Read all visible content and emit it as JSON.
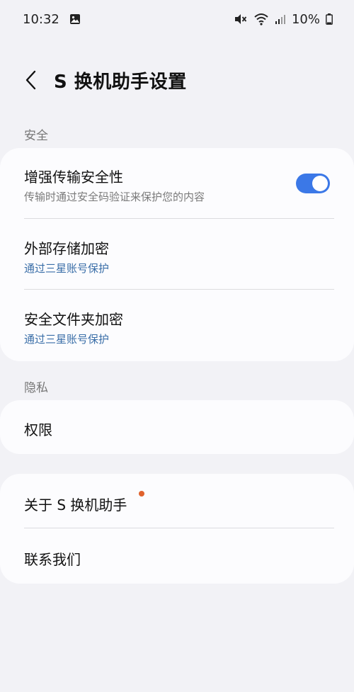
{
  "status_bar": {
    "time": "10:32",
    "battery": "10%",
    "icons": [
      "gallery-icon",
      "mute-icon",
      "wifi-icon",
      "signal-icon",
      "battery-icon"
    ]
  },
  "header": {
    "title": "S 换机助手设置"
  },
  "sections": {
    "security": {
      "title": "安全",
      "items": [
        {
          "title": "增强传输安全性",
          "subtitle": "传输时通过安全码验证来保护您的内容",
          "toggle_on": true
        },
        {
          "title": "外部存储加密",
          "subtitle": "通过三星账号保护"
        },
        {
          "title": "安全文件夹加密",
          "subtitle": "通过三星账号保护"
        }
      ]
    },
    "privacy": {
      "title": "隐私",
      "items": [
        {
          "title": "权限"
        }
      ]
    },
    "about": {
      "items": [
        {
          "title": "关于 S 换机助手",
          "has_badge": true
        },
        {
          "title": "联系我们"
        }
      ]
    }
  },
  "colors": {
    "background": "#f2f2f6",
    "card": "#fcfcfe",
    "accent": "#3b78e7",
    "link_blue": "#3a6ea8",
    "badge": "#e0622d"
  }
}
